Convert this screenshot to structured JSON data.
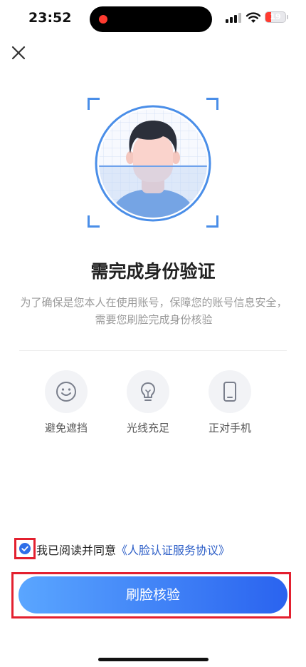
{
  "status_bar": {
    "time": "23:52",
    "battery": "19",
    "battery_level": 0.19
  },
  "header": {
    "close_icon": "close-icon"
  },
  "illustration": {
    "icon": "face-scan-illustration",
    "accent": "#4a8ee8"
  },
  "title": "需完成身份验证",
  "description": "为了确保是您本人在使用账号，保障您的账号信息安全，需要您刷脸完成身份核验",
  "tips": [
    {
      "icon": "smile-face-icon",
      "label": "避免遮挡"
    },
    {
      "icon": "lightbulb-icon",
      "label": "光线充足"
    },
    {
      "icon": "phone-icon",
      "label": "正对手机"
    }
  ],
  "agreement": {
    "checked": true,
    "text": "我已阅读并同意",
    "link": "《人脸认证服务协议》"
  },
  "cta": {
    "label": "刷脸核验"
  },
  "colors": {
    "primary": "#2f6ee8",
    "highlight": "#e3202f",
    "link": "#2c5ec7"
  }
}
